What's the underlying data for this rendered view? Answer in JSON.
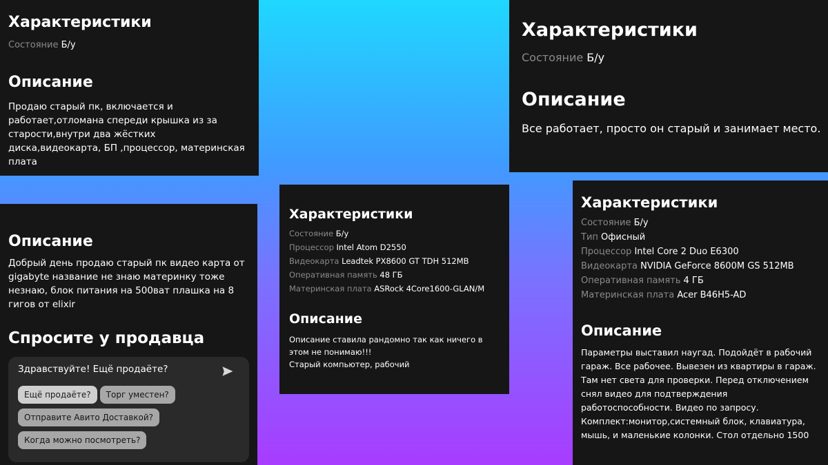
{
  "card1": {
    "specs_title": "Характеристики",
    "specs": [
      {
        "label": "Состояние",
        "value": "Б/у"
      }
    ],
    "desc_title": "Описание",
    "desc": "Продаю старый пк, включается и работает,отломана спереди крышка из за старости,внутри два жёстких диска,видеокарта, БП ,процессор, материнская плата"
  },
  "card2": {
    "specs_title": "Характеристики",
    "specs": [
      {
        "label": "Состояние",
        "value": "Б/у"
      }
    ],
    "desc_title": "Описание",
    "desc": "Все работает, просто он старый и занимает место."
  },
  "card3": {
    "desc_title": "Описание",
    "desc": "Добрый день продаю старый пк видео карта от gigabyte название не знаю материнку тоже незнаю, блок питания на 500ват плашка на 8 гигов от elixir",
    "ask_title": "Спросите у продавца",
    "chat_message": "Здравствуйте! Ещё продаёте?",
    "send_icon": "send-icon",
    "quick_replies": [
      "Ещё продаёте?",
      "Торг уместен?",
      "Отправите Авито Доставкой?",
      "Когда можно посмотреть?"
    ]
  },
  "card4": {
    "specs_title": "Характеристики",
    "specs": [
      {
        "label": "Состояние",
        "value": "Б/у"
      },
      {
        "label": "Процессор",
        "value": "Intel Atom D2550"
      },
      {
        "label": "Видеокарта",
        "value": "Leadtek PX8600 GT TDH 512MB"
      },
      {
        "label": "Оперативная память",
        "value": "48 ГБ"
      },
      {
        "label": "Материнская плата",
        "value": "ASRock 4Core1600-GLAN/M"
      }
    ],
    "desc_title": "Описание",
    "desc_line1": "Описание ставила рандомно так как ничего в этом не понимаю!!!",
    "desc_line2": "Старый компьютер, рабочий"
  },
  "card5": {
    "specs_title": "Характеристики",
    "specs": [
      {
        "label": "Состояние",
        "value": "Б/у"
      },
      {
        "label": "Тип",
        "value": "Офисный"
      },
      {
        "label": "Процессор",
        "value": "Intel Core 2 Duo E6300"
      },
      {
        "label": "Видеокарта",
        "value": "NVIDIA GeForce 8600M GS 512MB"
      },
      {
        "label": "Оперативная память",
        "value": "4 ГБ"
      },
      {
        "label": "Материнская плата",
        "value": "Acer B46H5-AD"
      }
    ],
    "desc_title": "Описание",
    "desc": "Параметры выставил наугад. Подойдёт в рабочий гараж. Все рабочее. Вывезен из квартиры в гараж. Там нет света для проверки. Перед отключением снял видео для подтверждения работоспособности. Видео по запросу. Комплект:монитор,системный блок, клавиатура, мышь, и маленькие колонки. Стол отдельно 1500"
  }
}
